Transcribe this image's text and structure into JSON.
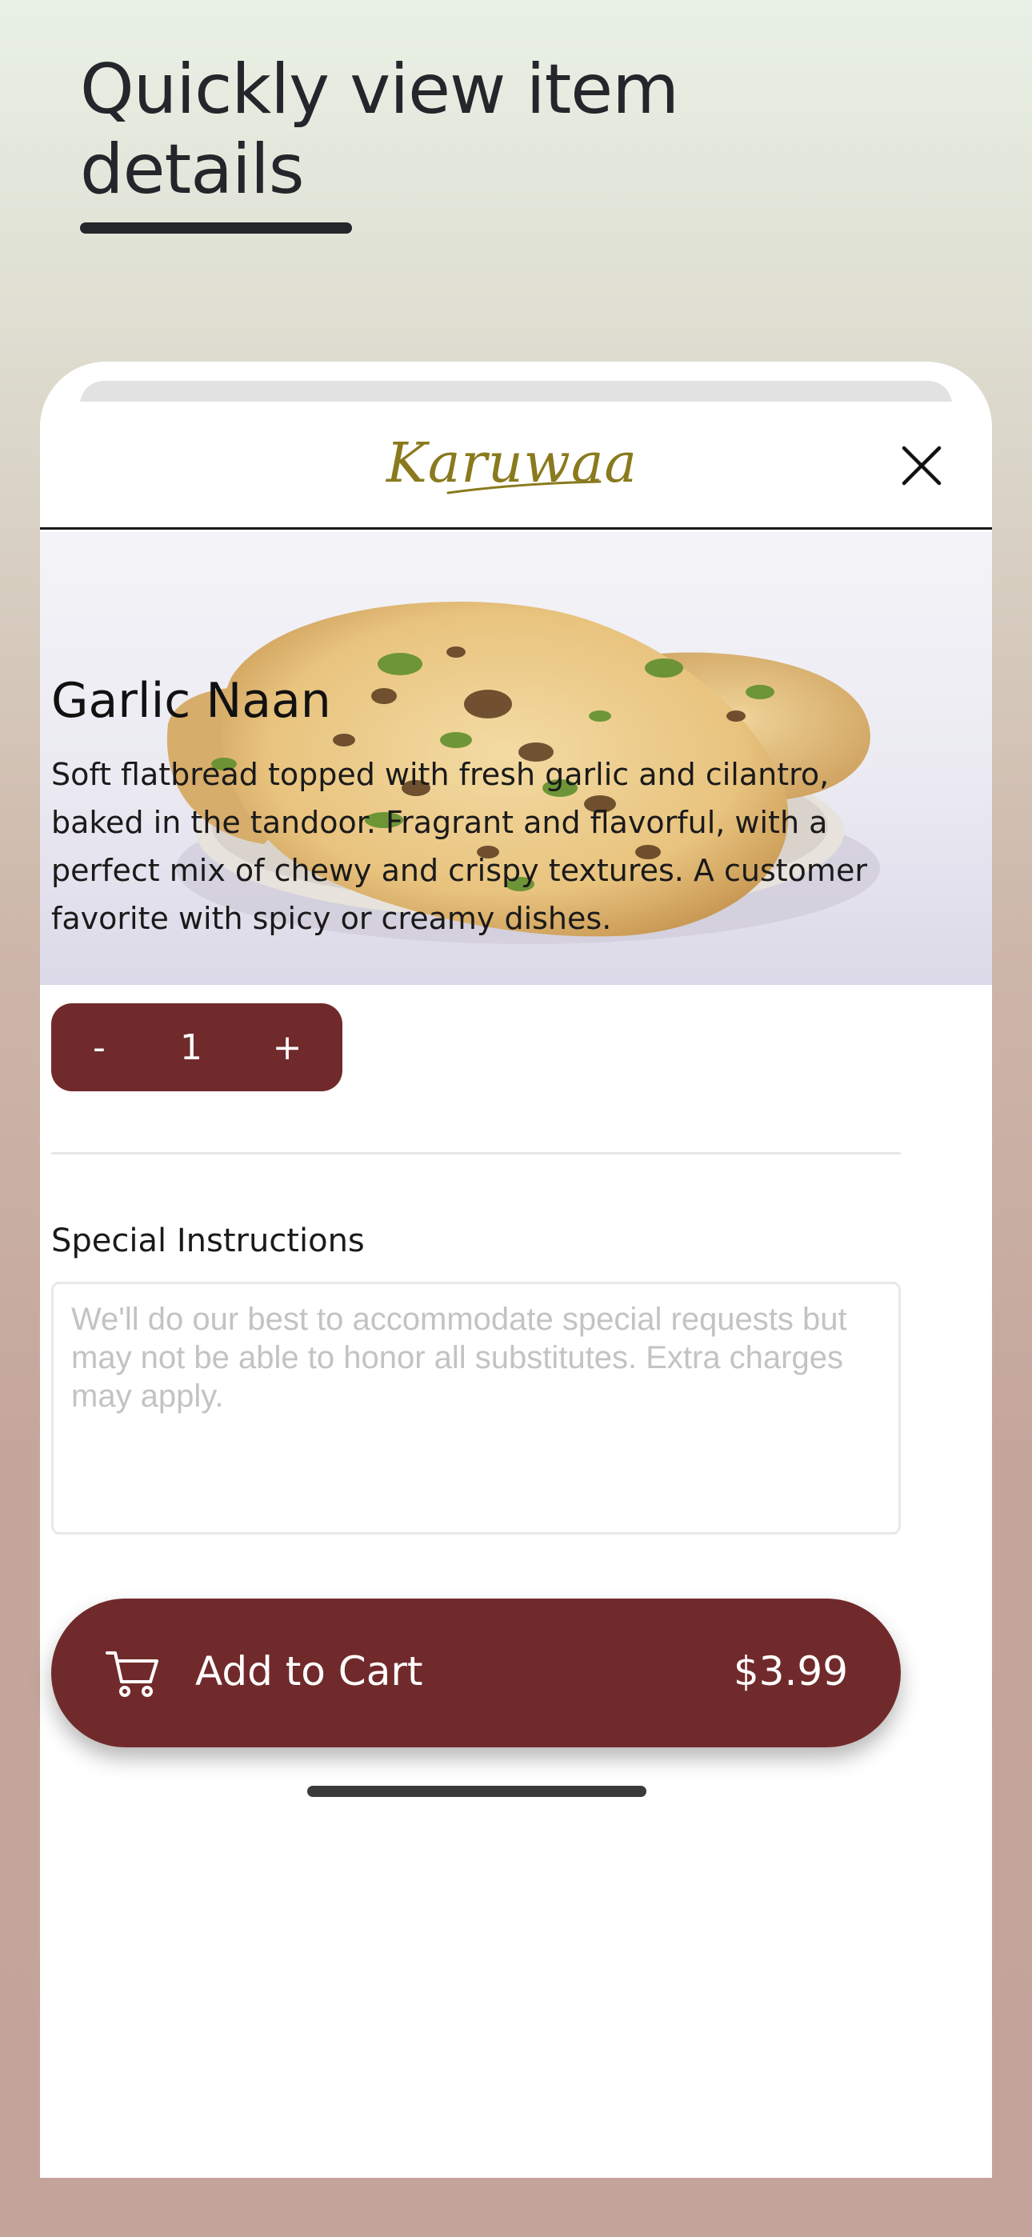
{
  "promo": {
    "headline_line1": "Quickly view item",
    "headline_line2": "details"
  },
  "header": {
    "logo_text": "Karuwaa",
    "close_icon": "close-icon"
  },
  "item": {
    "image_icon": "garlic-naan-photo",
    "name": "Garlic Naan",
    "description": "Soft flatbread topped with fresh garlic and cilantro, baked in the tandoor. Fragrant and flavorful, with a perfect mix of chewy and crispy textures. A customer favorite with spicy or creamy dishes."
  },
  "quantity": {
    "minus_label": "-",
    "value": "1",
    "plus_label": "+"
  },
  "special_instructions": {
    "label": "Special Instructions",
    "value": "",
    "placeholder": "We'll do our best to accommodate special requests but may not be able to honor all substitutes. Extra charges may apply."
  },
  "cart": {
    "icon": "cart-icon",
    "label": "Add to Cart",
    "price": "$3.99"
  },
  "colors": {
    "brand": "#712a2b",
    "logo_gold": "#8a7a1e",
    "background_top": "#e9f1e6",
    "background_bottom": "#c4a49a"
  }
}
